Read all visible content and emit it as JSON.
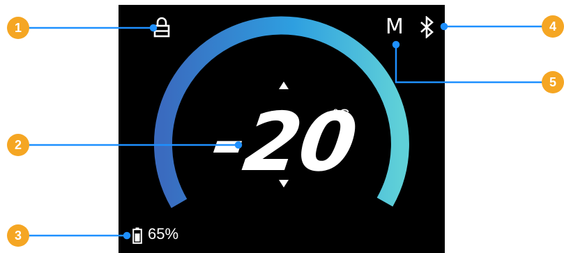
{
  "thermostat": {
    "temperature": "-20",
    "unit": "°C",
    "battery_percent": "65%",
    "mode_letter": "M"
  },
  "callouts": [
    "1",
    "2",
    "3",
    "4",
    "5"
  ],
  "colors": {
    "screen_bg": "#000000",
    "arc_start": "#3a6bbf",
    "arc_mid": "#2e9fe0",
    "arc_end": "#5fd0d8",
    "callout_badge": "#f5a623",
    "callout_line": "#1e90ff"
  },
  "icons": {
    "lock": "lock-icon",
    "bluetooth": "bluetooth-icon",
    "battery": "battery-icon",
    "up": "arrow-up-icon",
    "down": "arrow-down-icon"
  }
}
